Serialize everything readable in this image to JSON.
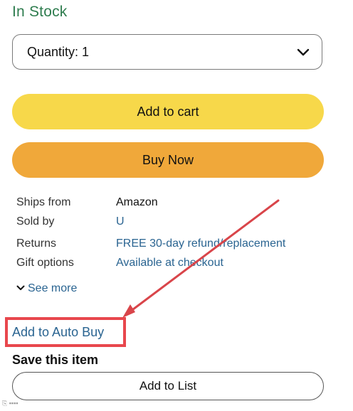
{
  "availability": "In Stock",
  "quantity": {
    "label": "Quantity: 1"
  },
  "buttons": {
    "add_to_cart": "Add to cart",
    "buy_now": "Buy Now",
    "add_to_list": "Add to List"
  },
  "details": [
    {
      "label": "Ships from",
      "value": "Amazon"
    },
    {
      "label": "Sold by",
      "value": "U"
    },
    {
      "label": "Returns",
      "value": "FREE 30-day refund/replacement"
    },
    {
      "label": "Gift options",
      "value": "Available at checkout"
    }
  ],
  "see_more": "See more",
  "auto_buy": "Add to Auto Buy",
  "save_title": "Save this item",
  "colors": {
    "stock_green": "#2f7d4f",
    "link_blue": "#2a6491",
    "cart_yellow": "#f7d84a",
    "buy_orange": "#f0a83a",
    "annotation_red": "#e8474d"
  }
}
